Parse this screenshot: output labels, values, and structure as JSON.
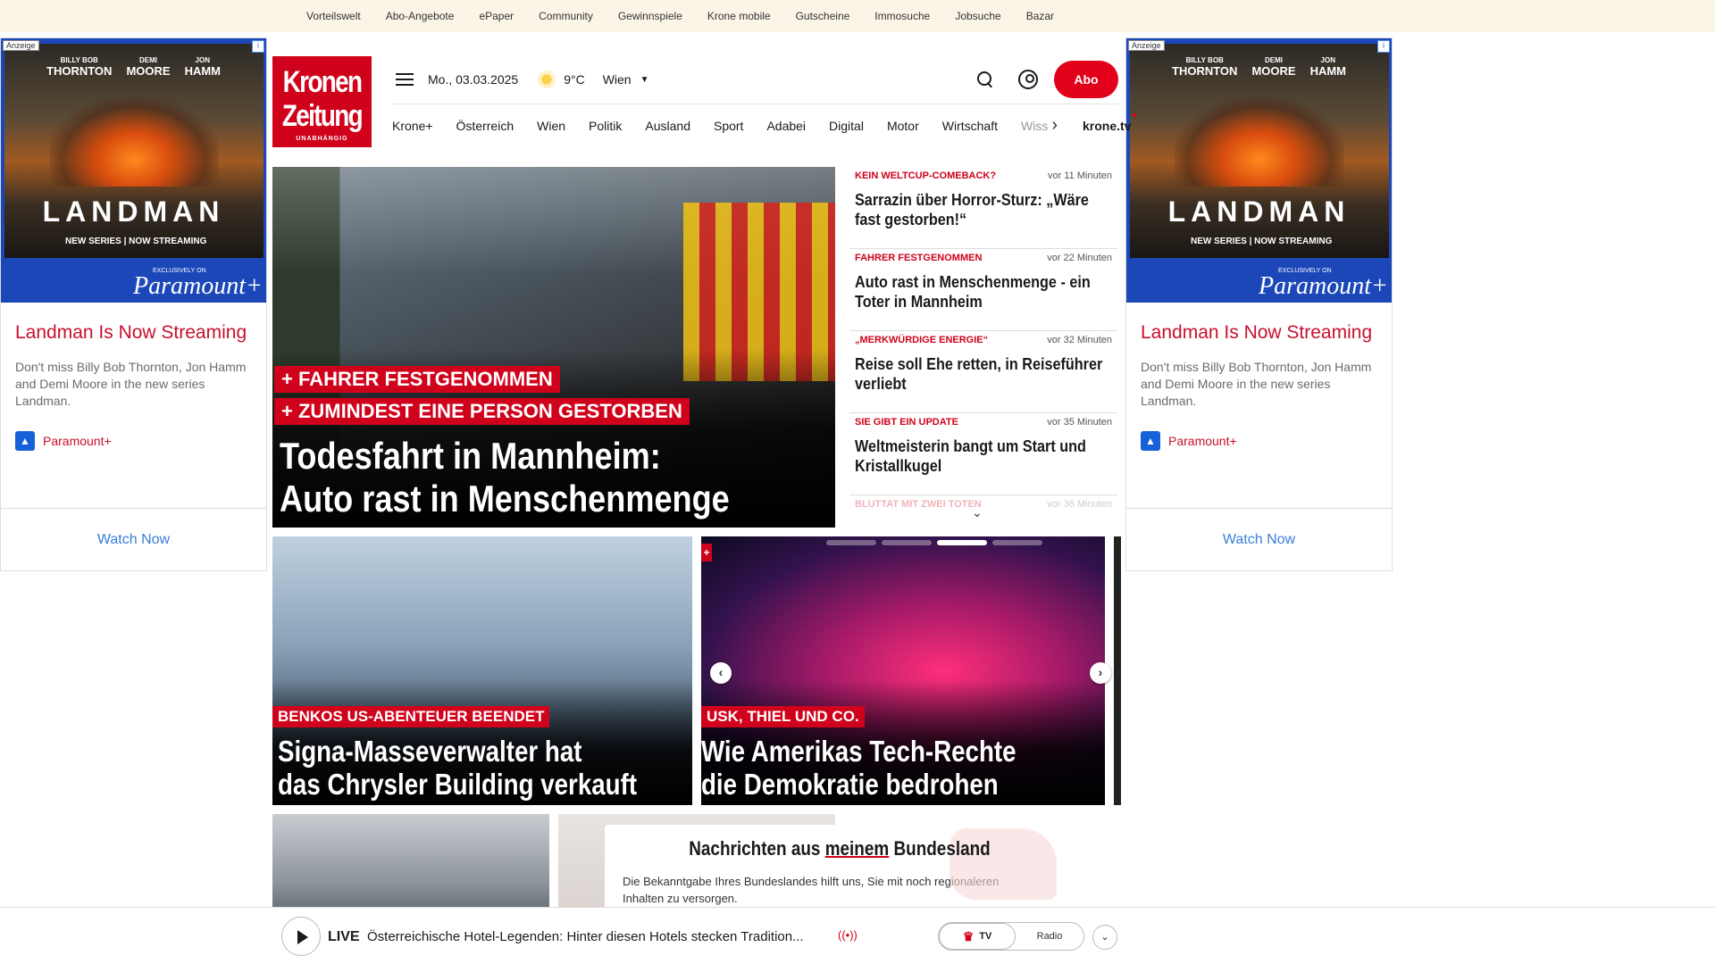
{
  "topbar": {
    "links": [
      "Vorteilswelt",
      "Abo-Angebote",
      "ePaper",
      "Community",
      "Gewinnspiele",
      "Krone mobile",
      "Gutscheine",
      "Immosuche",
      "Jobsuche",
      "Bazar"
    ]
  },
  "ad": {
    "label": "Anzeige",
    "info": "i",
    "names": [
      {
        "first": "BILLY BOB",
        "last": "THORNTON"
      },
      {
        "first": "DEMI",
        "last": "MOORE"
      },
      {
        "first": "JON",
        "last": "HAMM"
      }
    ],
    "show_title": "LANDMAN",
    "show_sub": "NEW SERIES | NOW STREAMING",
    "exclusive": "EXCLUSIVELY ON",
    "brand": "Paramount+",
    "headline": "Landman Is Now Streaming",
    "description": "Don't miss Billy Bob Thornton, Jon Hamm and Demi Moore in the new series Landman.",
    "advertiser": "Paramount+",
    "cta": "Watch Now"
  },
  "logo": {
    "line1": "Kronen",
    "line2": "Zeitung",
    "line3": "UNABHÄNGIG"
  },
  "header": {
    "date": "Mo., 03.03.2025",
    "temp": "9°C",
    "city": "Wien",
    "abo": "Abo"
  },
  "nav": {
    "items": [
      "Krone+",
      "Österreich",
      "Wien",
      "Politik",
      "Ausland",
      "Sport",
      "Adabei",
      "Digital",
      "Motor",
      "Wirtschaft"
    ],
    "faded": "Wiss",
    "tv": "krone.tv"
  },
  "hero": {
    "kicker1": "+ FAHRER FESTGENOMMEN",
    "kicker2": "+ ZUMINDEST EINE PERSON GESTORBEN",
    "title_line1": "Todesfahrt in Mannheim:",
    "title_line2": "Auto rast in Menschenmenge"
  },
  "ticker": {
    "items": [
      {
        "kicker": "KEIN WELTCUP-COMEBACK?",
        "time": "vor 11 Minuten",
        "title": "Sarrazin über Horror-Sturz: „Wäre fast gestorben!“"
      },
      {
        "kicker": "FAHRER FESTGENOMMEN",
        "time": "vor 22 Minuten",
        "title": "Auto rast in Menschenmenge - ein Toter in Mannheim"
      },
      {
        "kicker": "„MERKWÜRDIGE ENERGIE“",
        "time": "vor 32 Minuten",
        "title": "Reise soll Ehe retten, in Reiseführer verliebt"
      },
      {
        "kicker": "SIE GIBT EIN UPDATE",
        "time": "vor 35 Minuten",
        "title": "Weltmeisterin bangt um Start und Kristallkugel"
      }
    ],
    "faded_kicker": "BLUTTAT MIT ZWEI TOTEN",
    "faded_time": "vor 36 Minuten"
  },
  "cards": [
    {
      "kicker": "BENKOS US-ABENTEUER BEENDET",
      "title_line1": "Signa-Masseverwalter hat",
      "title_line2": "das Chrysler Building verkauft"
    },
    {
      "kicker": "USK, THIEL UND CO.",
      "title_line1": "Wie Amerikas Tech-Rechte",
      "title_line2": "die Demokratie bedrohen"
    }
  ],
  "bundesland": {
    "title_pre": "Nachrichten aus ",
    "title_em": "meinem",
    "title_post": " Bundesland",
    "text": "Die Bekanntgabe Ihres Bundeslandes hilft uns, Sie mit noch regionaleren Inhalten zu versorgen."
  },
  "player": {
    "live": "LIVE",
    "title": "Österreichische Hotel-Legenden: Hinter diesen Hotels stecken Tradition...",
    "tv": "TV",
    "radio": "Radio"
  }
}
